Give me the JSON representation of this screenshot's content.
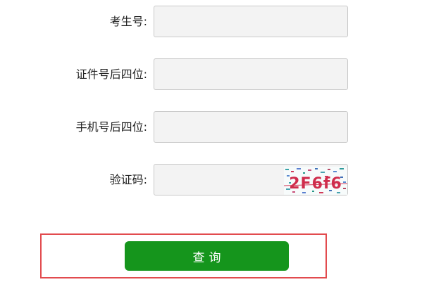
{
  "form": {
    "fields": [
      {
        "label": "考生号:",
        "value": "",
        "placeholder": ""
      },
      {
        "label": "证件号后四位:",
        "value": "",
        "placeholder": ""
      },
      {
        "label": "手机号后四位:",
        "value": "",
        "placeholder": ""
      },
      {
        "label": "验证码:",
        "value": "",
        "placeholder": ""
      }
    ],
    "captcha_text": "2F6f6",
    "submit_label": "查询"
  },
  "colors": {
    "button_bg": "#15951c",
    "highlight_border": "#e24b4e",
    "field_bg": "#f3f3f3"
  }
}
